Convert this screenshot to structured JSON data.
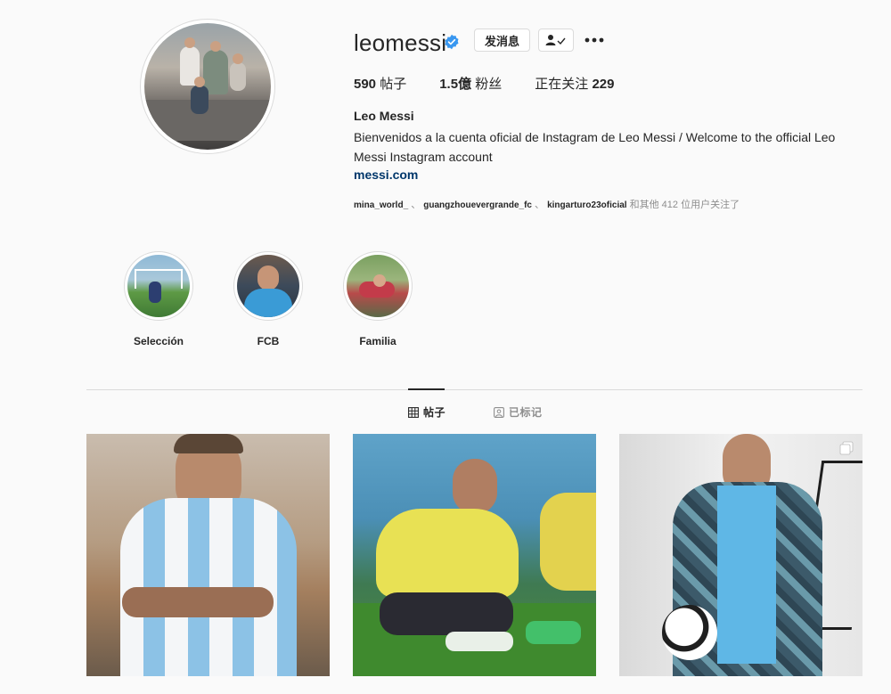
{
  "profile": {
    "username": "leomessi",
    "message_button": "发消息",
    "stats": {
      "posts_count": "590",
      "posts_label": "帖子",
      "followers_count": "1.5億",
      "followers_label": "粉丝",
      "following_label": "正在关注",
      "following_count": "229"
    },
    "full_name": "Leo Messi",
    "bio": "Bienvenidos a la cuenta oficial de Instagram de Leo Messi / Welcome to the official Leo Messi Instagram account",
    "website": "messi.com",
    "followed_by": {
      "users": [
        "mina_world_",
        "guangzhouevergrande_fc",
        "kingarturo23oficial"
      ],
      "separator": "、",
      "suffix": "和其他 412 位用户关注了"
    }
  },
  "highlights": [
    {
      "label": "Selección"
    },
    {
      "label": "FCB"
    },
    {
      "label": "Familia"
    }
  ],
  "tabs": [
    {
      "label": "帖子",
      "icon": "grid-icon",
      "active": true
    },
    {
      "label": "已标记",
      "icon": "tagged-icon",
      "active": false
    }
  ],
  "posts": [
    {
      "icon": "photo"
    },
    {
      "icon": "photo"
    },
    {
      "icon": "carousel-icon"
    }
  ],
  "colors": {
    "verified": "#3897f0",
    "link": "#00376b",
    "muted": "#8e8e8e",
    "border": "#dbdbdb"
  }
}
